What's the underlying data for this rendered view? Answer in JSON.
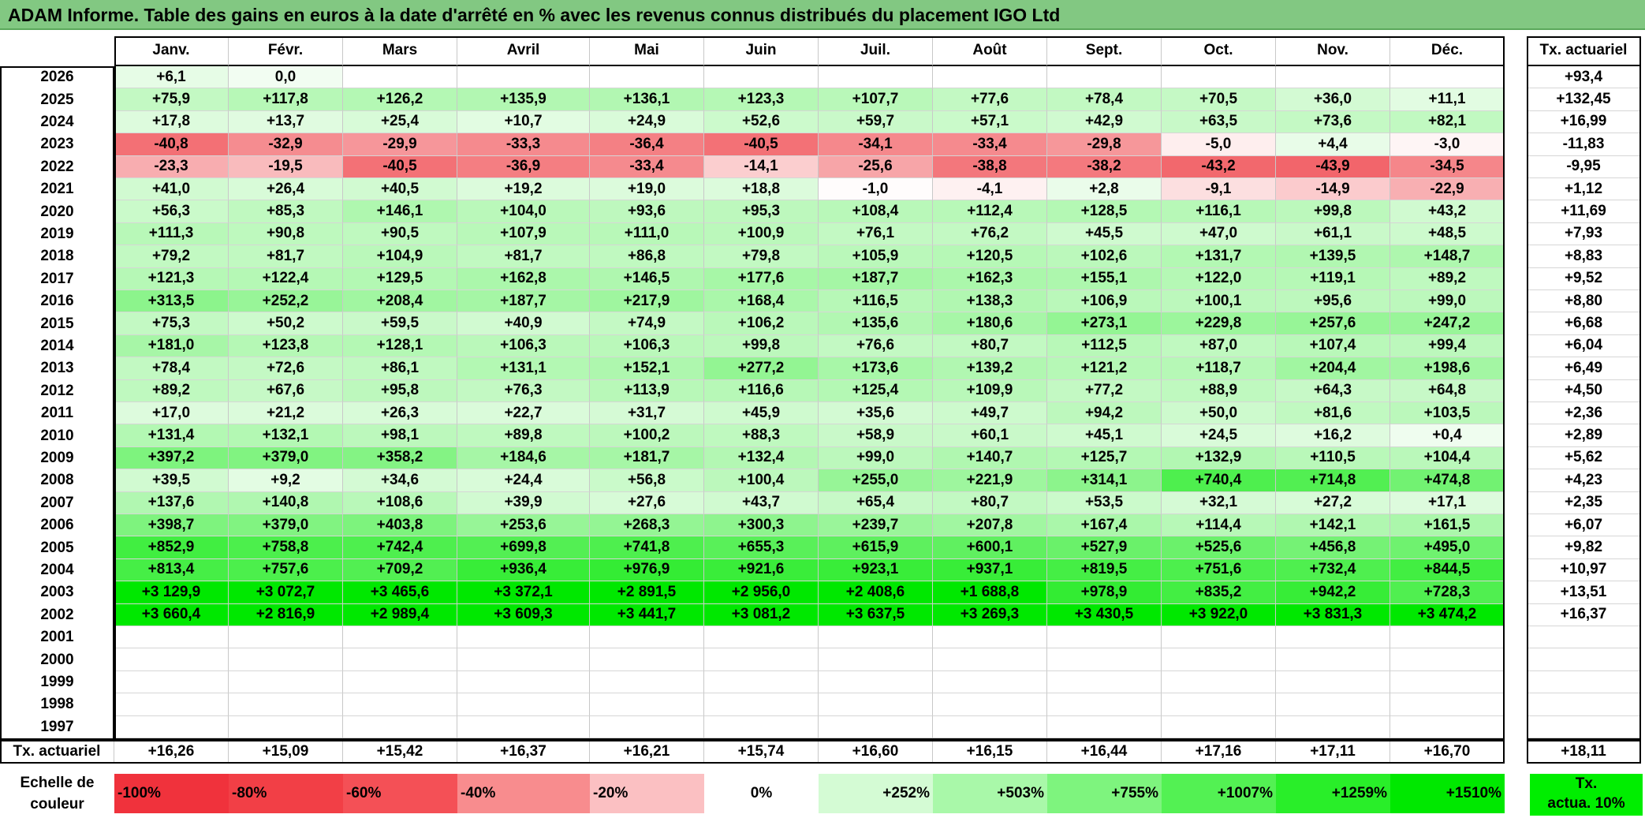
{
  "title": "ADAM Informe. Table des gains en euros à la date d'arrêté en % avec les revenus connus distribués du placement IGO Ltd",
  "months": [
    "Janv.",
    "Févr.",
    "Mars",
    "Avril",
    "Mai",
    "Juin",
    "Juil.",
    "Août",
    "Sept.",
    "Oct.",
    "Nov.",
    "Déc."
  ],
  "right_header": "Tx. actuariel",
  "rows": [
    {
      "year": "2026",
      "vals": [
        "+6,1",
        "0,0",
        "",
        "",
        "",
        "",
        "",
        "",
        "",
        "",
        "",
        ""
      ],
      "tx": "+93,4"
    },
    {
      "year": "2025",
      "vals": [
        "+75,9",
        "+117,8",
        "+126,2",
        "+135,9",
        "+136,1",
        "+123,3",
        "+107,7",
        "+77,6",
        "+78,4",
        "+70,5",
        "+36,0",
        "+11,1"
      ],
      "tx": "+132,45"
    },
    {
      "year": "2024",
      "vals": [
        "+17,8",
        "+13,7",
        "+25,4",
        "+10,7",
        "+24,9",
        "+52,6",
        "+59,7",
        "+57,1",
        "+42,9",
        "+63,5",
        "+73,6",
        "+82,1"
      ],
      "tx": "+16,99"
    },
    {
      "year": "2023",
      "vals": [
        "-40,8",
        "-32,9",
        "-29,9",
        "-33,3",
        "-36,4",
        "-40,5",
        "-34,1",
        "-33,4",
        "-29,8",
        "-5,0",
        "+4,4",
        "-3,0"
      ],
      "tx": "-11,83"
    },
    {
      "year": "2022",
      "vals": [
        "-23,3",
        "-19,5",
        "-40,5",
        "-36,9",
        "-33,4",
        "-14,1",
        "-25,6",
        "-38,8",
        "-38,2",
        "-43,2",
        "-43,9",
        "-34,5"
      ],
      "tx": "-9,95"
    },
    {
      "year": "2021",
      "vals": [
        "+41,0",
        "+26,4",
        "+40,5",
        "+19,2",
        "+19,0",
        "+18,8",
        "-1,0",
        "-4,1",
        "+2,8",
        "-9,1",
        "-14,9",
        "-22,9"
      ],
      "tx": "+1,12"
    },
    {
      "year": "2020",
      "vals": [
        "+56,3",
        "+85,3",
        "+146,1",
        "+104,0",
        "+93,6",
        "+95,3",
        "+108,4",
        "+112,4",
        "+128,5",
        "+116,1",
        "+99,8",
        "+43,2"
      ],
      "tx": "+11,69"
    },
    {
      "year": "2019",
      "vals": [
        "+111,3",
        "+90,8",
        "+90,5",
        "+107,9",
        "+111,0",
        "+100,9",
        "+76,1",
        "+76,2",
        "+45,5",
        "+47,0",
        "+61,1",
        "+48,5"
      ],
      "tx": "+7,93"
    },
    {
      "year": "2018",
      "vals": [
        "+79,2",
        "+81,7",
        "+104,9",
        "+81,7",
        "+86,8",
        "+79,8",
        "+105,9",
        "+120,5",
        "+102,6",
        "+131,7",
        "+139,5",
        "+148,7"
      ],
      "tx": "+8,83"
    },
    {
      "year": "2017",
      "vals": [
        "+121,3",
        "+122,4",
        "+129,5",
        "+162,8",
        "+146,5",
        "+177,6",
        "+187,7",
        "+162,3",
        "+155,1",
        "+122,0",
        "+119,1",
        "+89,2"
      ],
      "tx": "+9,52"
    },
    {
      "year": "2016",
      "vals": [
        "+313,5",
        "+252,2",
        "+208,4",
        "+187,7",
        "+217,9",
        "+168,4",
        "+116,5",
        "+138,3",
        "+106,9",
        "+100,1",
        "+95,6",
        "+99,0"
      ],
      "tx": "+8,80"
    },
    {
      "year": "2015",
      "vals": [
        "+75,3",
        "+50,2",
        "+59,5",
        "+40,9",
        "+74,9",
        "+106,2",
        "+135,6",
        "+180,6",
        "+273,1",
        "+229,8",
        "+257,6",
        "+247,2"
      ],
      "tx": "+6,68"
    },
    {
      "year": "2014",
      "vals": [
        "+181,0",
        "+123,8",
        "+128,1",
        "+106,3",
        "+106,3",
        "+99,8",
        "+76,6",
        "+80,7",
        "+112,5",
        "+87,0",
        "+107,4",
        "+99,4"
      ],
      "tx": "+6,04"
    },
    {
      "year": "2013",
      "vals": [
        "+78,4",
        "+72,6",
        "+86,1",
        "+131,1",
        "+152,1",
        "+277,2",
        "+173,6",
        "+139,2",
        "+121,2",
        "+118,7",
        "+204,4",
        "+198,6"
      ],
      "tx": "+6,49"
    },
    {
      "year": "2012",
      "vals": [
        "+89,2",
        "+67,6",
        "+95,8",
        "+76,3",
        "+113,9",
        "+116,6",
        "+125,4",
        "+109,9",
        "+77,2",
        "+88,9",
        "+64,3",
        "+64,8"
      ],
      "tx": "+4,50"
    },
    {
      "year": "2011",
      "vals": [
        "+17,0",
        "+21,2",
        "+26,3",
        "+22,7",
        "+31,7",
        "+45,9",
        "+35,6",
        "+49,7",
        "+94,2",
        "+50,0",
        "+81,6",
        "+103,5"
      ],
      "tx": "+2,36"
    },
    {
      "year": "2010",
      "vals": [
        "+131,4",
        "+132,1",
        "+98,1",
        "+89,8",
        "+100,2",
        "+88,3",
        "+58,9",
        "+60,1",
        "+45,1",
        "+24,5",
        "+16,2",
        "+0,4"
      ],
      "tx": "+2,89"
    },
    {
      "year": "2009",
      "vals": [
        "+397,2",
        "+379,0",
        "+358,2",
        "+184,6",
        "+181,7",
        "+132,4",
        "+99,0",
        "+140,7",
        "+125,7",
        "+132,9",
        "+110,5",
        "+104,4"
      ],
      "tx": "+5,62"
    },
    {
      "year": "2008",
      "vals": [
        "+39,5",
        "+9,2",
        "+34,6",
        "+24,4",
        "+56,8",
        "+100,4",
        "+255,0",
        "+221,9",
        "+314,1",
        "+740,4",
        "+714,8",
        "+474,8"
      ],
      "tx": "+4,23"
    },
    {
      "year": "2007",
      "vals": [
        "+137,6",
        "+140,8",
        "+108,6",
        "+39,9",
        "+27,6",
        "+43,7",
        "+65,4",
        "+80,7",
        "+53,5",
        "+32,1",
        "+27,2",
        "+17,1"
      ],
      "tx": "+2,35"
    },
    {
      "year": "2006",
      "vals": [
        "+398,7",
        "+379,0",
        "+403,8",
        "+253,6",
        "+268,3",
        "+300,3",
        "+239,7",
        "+207,8",
        "+167,4",
        "+114,4",
        "+142,1",
        "+161,5"
      ],
      "tx": "+6,07"
    },
    {
      "year": "2005",
      "vals": [
        "+852,9",
        "+758,8",
        "+742,4",
        "+699,8",
        "+741,8",
        "+655,3",
        "+615,9",
        "+600,1",
        "+527,9",
        "+525,6",
        "+456,8",
        "+495,0"
      ],
      "tx": "+9,82"
    },
    {
      "year": "2004",
      "vals": [
        "+813,4",
        "+757,6",
        "+709,2",
        "+936,4",
        "+976,9",
        "+921,6",
        "+923,1",
        "+937,1",
        "+819,5",
        "+751,6",
        "+732,4",
        "+844,5"
      ],
      "tx": "+10,97"
    },
    {
      "year": "2003",
      "vals": [
        "+3 129,9",
        "+3 072,7",
        "+3 465,6",
        "+3 372,1",
        "+2 891,5",
        "+2 956,0",
        "+2 408,6",
        "+1 688,8",
        "+978,9",
        "+835,2",
        "+942,2",
        "+728,3"
      ],
      "tx": "+13,51"
    },
    {
      "year": "2002",
      "vals": [
        "+3 660,4",
        "+2 816,9",
        "+2 989,4",
        "+3 609,3",
        "+3 441,7",
        "+3 081,2",
        "+3 637,5",
        "+3 269,3",
        "+3 430,5",
        "+3 922,0",
        "+3 831,3",
        "+3 474,2"
      ],
      "tx": "+16,37"
    },
    {
      "year": "2001",
      "vals": [
        "",
        "",
        "",
        "",
        "",
        "",
        "",
        "",
        "",
        "",
        "",
        ""
      ],
      "tx": ""
    },
    {
      "year": "2000",
      "vals": [
        "",
        "",
        "",
        "",
        "",
        "",
        "",
        "",
        "",
        "",
        "",
        ""
      ],
      "tx": ""
    },
    {
      "year": "1999",
      "vals": [
        "",
        "",
        "",
        "",
        "",
        "",
        "",
        "",
        "",
        "",
        "",
        ""
      ],
      "tx": ""
    },
    {
      "year": "1998",
      "vals": [
        "",
        "",
        "",
        "",
        "",
        "",
        "",
        "",
        "",
        "",
        "",
        ""
      ],
      "tx": ""
    },
    {
      "year": "1997",
      "vals": [
        "",
        "",
        "",
        "",
        "",
        "",
        "",
        "",
        "",
        "",
        "",
        ""
      ],
      "tx": ""
    }
  ],
  "footer": {
    "label": "Tx. actuariel",
    "vals": [
      "+16,26",
      "+15,09",
      "+15,42",
      "+16,37",
      "+16,21",
      "+15,74",
      "+16,60",
      "+16,15",
      "+16,44",
      "+17,16",
      "+17,11",
      "+16,70"
    ],
    "tx": "+18,11"
  },
  "scale": {
    "label_line1": "Echelle de",
    "label_line2": "couleur",
    "items": [
      {
        "text": "-100%",
        "color": "#f0323c",
        "align": "left"
      },
      {
        "text": "-80%",
        "color": "#f23f46",
        "align": "left"
      },
      {
        "text": "-60%",
        "color": "#f45056",
        "align": "left"
      },
      {
        "text": "-40%",
        "color": "#f88c8e",
        "align": "left"
      },
      {
        "text": "-20%",
        "color": "#fbc0c2",
        "align": "left"
      },
      {
        "text": "0%",
        "color": "#ffffff",
        "align": "center"
      },
      {
        "text": "+252%",
        "color": "#d4fbd4",
        "align": "right"
      },
      {
        "text": "+503%",
        "color": "#a9f8a9",
        "align": "right"
      },
      {
        "text": "+755%",
        "color": "#7ef47e",
        "align": "right"
      },
      {
        "text": "+1007%",
        "color": "#53f153",
        "align": "right"
      },
      {
        "text": "+1259%",
        "color": "#29ee29",
        "align": "right"
      },
      {
        "text": "+1510%",
        "color": "#00e800",
        "align": "right"
      }
    ],
    "right_line1": "Tx.",
    "right_line2": "actua. 10%",
    "right_color": "#00ee00"
  }
}
